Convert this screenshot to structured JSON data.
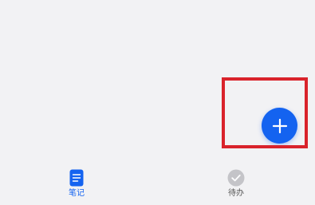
{
  "fab": {
    "icon": "plus-icon",
    "color": "#1463f0"
  },
  "highlight": {
    "color": "#d9232b"
  },
  "bottom_nav": {
    "items": [
      {
        "label": "笔记",
        "icon": "note-icon",
        "active": true,
        "color": "#1463f0"
      },
      {
        "label": "待办",
        "icon": "check-circle-icon",
        "active": false,
        "color": "#555555"
      }
    ]
  }
}
